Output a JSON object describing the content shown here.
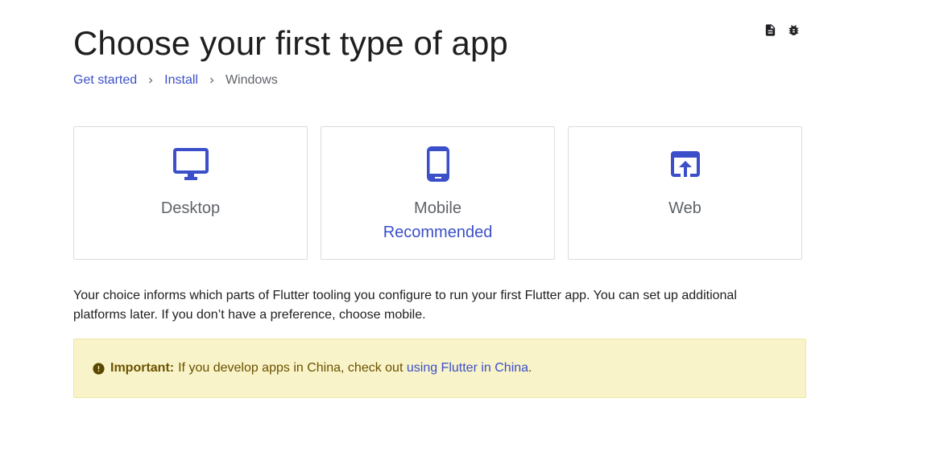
{
  "page": {
    "title": "Choose your first type of app"
  },
  "top_icons": [
    "document-icon",
    "bug-icon"
  ],
  "breadcrumb": {
    "items": [
      {
        "label": "Get started",
        "link": true
      },
      {
        "label": "Install",
        "link": true
      },
      {
        "label": "Windows",
        "link": false
      }
    ]
  },
  "cards": [
    {
      "label": "Desktop",
      "sub": "",
      "icon": "desktop-icon"
    },
    {
      "label": "Mobile",
      "sub": "Recommended",
      "icon": "mobile-icon"
    },
    {
      "label": "Web",
      "sub": "",
      "icon": "web-icon"
    }
  ],
  "description": "Your choice informs which parts of Flutter tooling you configure to run your first Flutter app. You can set up additional platforms later. If you don’t have a preference, choose mobile.",
  "callout": {
    "heading": "Important:",
    "text": "If you develop apps in China, check out",
    "link_text": "using Flutter in China",
    "trailing": "."
  },
  "colors": {
    "accent": "#3b4fc9",
    "callout_bg": "#f8f3c8",
    "callout_text": "#6b5200"
  }
}
